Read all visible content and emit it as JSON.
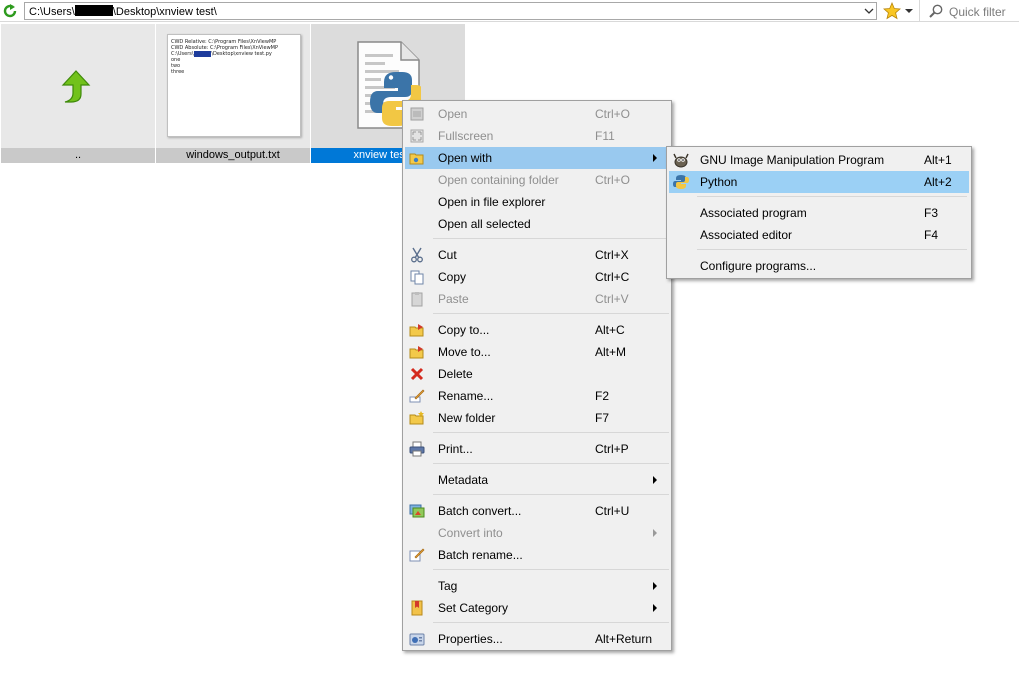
{
  "address_bar": {
    "path_prefix": "C:\\Users\\",
    "path_suffix": "\\Desktop\\xnview test\\",
    "filter_placeholder": "Quick filter"
  },
  "thumbnails": [
    {
      "caption": "..",
      "icon": "up-arrow-icon"
    },
    {
      "caption": "windows_output.txt",
      "preview_lines": [
        "CWD Relative: C:\\Program Files\\XnViewMP",
        "CWD Absolute: C:\\Program Files\\XnViewMP",
        "C:\\Users\\",
        "\\Desktop\\xnview test.py",
        "one",
        "two",
        "three"
      ]
    },
    {
      "caption": "xnview test.py",
      "icon": "python-file-icon"
    }
  ],
  "context_menu": {
    "items": [
      {
        "label": "Open",
        "shortcut": "Ctrl+O",
        "disabled": true
      },
      {
        "label": "Fullscreen",
        "shortcut": "F11",
        "disabled": true
      },
      {
        "label": "Open with",
        "shortcut": "",
        "submenu": true,
        "highlighted": true
      },
      {
        "label": "Open containing folder",
        "shortcut": "Ctrl+O",
        "disabled": true
      },
      {
        "label": "Open in file explorer",
        "shortcut": ""
      },
      {
        "label": "Open all selected",
        "shortcut": ""
      },
      {
        "label": "Cut",
        "shortcut": "Ctrl+X"
      },
      {
        "label": "Copy",
        "shortcut": "Ctrl+C"
      },
      {
        "label": "Paste",
        "shortcut": "Ctrl+V",
        "disabled": true
      },
      {
        "label": "Copy to...",
        "shortcut": "Alt+C"
      },
      {
        "label": "Move to...",
        "shortcut": "Alt+M"
      },
      {
        "label": "Delete",
        "shortcut": ""
      },
      {
        "label": "Rename...",
        "shortcut": "F2"
      },
      {
        "label": "New folder",
        "shortcut": "F7"
      },
      {
        "label": "Print...",
        "shortcut": "Ctrl+P"
      },
      {
        "label": "Metadata",
        "shortcut": "",
        "submenu": true
      },
      {
        "label": "Batch convert...",
        "shortcut": "Ctrl+U"
      },
      {
        "label": "Convert into",
        "shortcut": "",
        "submenu": true,
        "disabled": true
      },
      {
        "label": "Batch rename...",
        "shortcut": ""
      },
      {
        "label": "Tag",
        "shortcut": "",
        "submenu": true
      },
      {
        "label": "Set Category",
        "shortcut": "",
        "submenu": true
      },
      {
        "label": "Properties...",
        "shortcut": "Alt+Return"
      }
    ]
  },
  "open_with_submenu": {
    "items": [
      {
        "label": "GNU Image Manipulation Program",
        "shortcut": "Alt+1"
      },
      {
        "label": "Python",
        "shortcut": "Alt+2",
        "highlighted": true
      },
      {
        "label": "Associated program",
        "shortcut": "F3"
      },
      {
        "label": "Associated editor",
        "shortcut": "F4"
      },
      {
        "label": "Configure programs...",
        "shortcut": ""
      }
    ]
  },
  "colors": {
    "selection": "#0078d7",
    "menu_highlight": "#99c9ef",
    "menu_bg": "#f0f0f0"
  }
}
